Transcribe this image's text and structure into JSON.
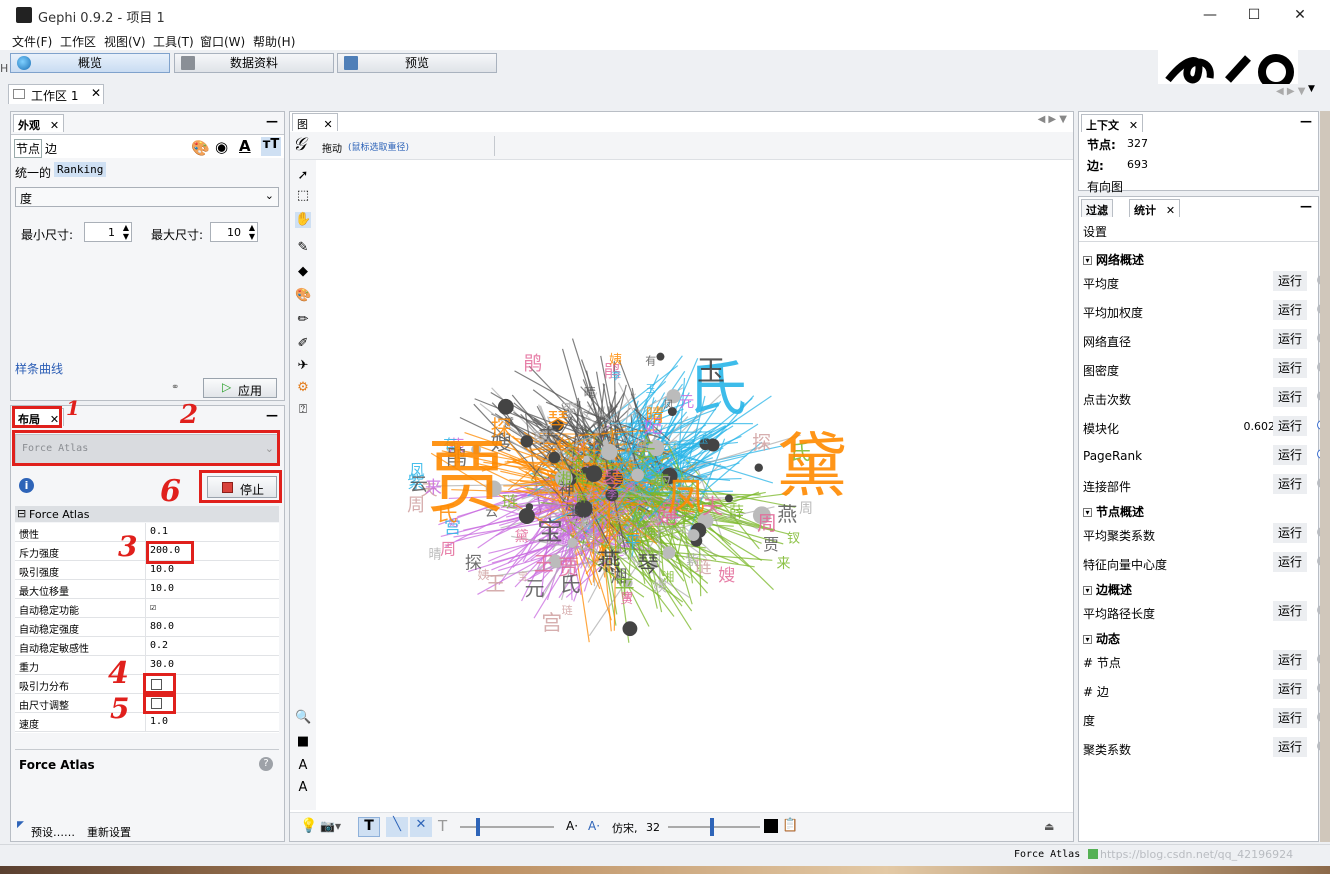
{
  "window": {
    "title": "Gephi 0.9.2 - 项目 1",
    "minimize": "—",
    "maximize": "☐",
    "close": "✕"
  },
  "menu": [
    "文件(F)",
    "工作区",
    "视图(V)",
    "工具(T)",
    "窗口(W)",
    "帮助(H)"
  ],
  "main_tabs": [
    "概览",
    "数据资料",
    "预览"
  ],
  "workspace_tab": "工作区 1",
  "appearance": {
    "title": "外观",
    "tab_nodes": "节点",
    "tab_edges": "边",
    "unique": "统一的",
    "ranking": "Ranking",
    "attribute": "度",
    "min_label": "最小尺寸:",
    "min_value": "1",
    "max_label": "最大尺寸:",
    "max_value": "10",
    "spline": "样条曲线",
    "apply": "应用"
  },
  "layout": {
    "title": "布局",
    "algorithm": "Force Atlas",
    "stop": "停止",
    "section": "Force Atlas",
    "props": [
      {
        "name": "惯性",
        "value": "0.1"
      },
      {
        "name": "斥力强度",
        "value": "200.0"
      },
      {
        "name": "吸引强度",
        "value": "10.0"
      },
      {
        "name": "最大位移量",
        "value": "10.0"
      },
      {
        "name": "自动稳定功能",
        "value": "☑"
      },
      {
        "name": "自动稳定强度",
        "value": "80.0"
      },
      {
        "name": "自动稳定敏感性",
        "value": "0.2"
      },
      {
        "name": "重力",
        "value": "30.0"
      },
      {
        "name": "吸引力分布",
        "value": ""
      },
      {
        "name": "由尺寸调整",
        "value": ""
      },
      {
        "name": "速度",
        "value": "1.0"
      }
    ],
    "desc_title": "Force Atlas",
    "presets": "预设……",
    "reset": "重新设置"
  },
  "annotations": [
    "1",
    "2",
    "3",
    "4",
    "5",
    "6"
  ],
  "graph": {
    "title": "图",
    "drag_tool": "拖动",
    "drag_hint": "(鼠标选取重径)",
    "font": "仿宋,",
    "font_size": "32",
    "words": [
      "贾",
      "宝",
      "黛",
      "氏",
      "玉",
      "周",
      "有",
      "凤",
      "妃",
      "燕",
      "琴",
      "神",
      "来",
      "李",
      "王",
      "宫",
      "钗",
      "夫",
      "姨",
      "嫂",
      "探",
      "元",
      "琏",
      "薛",
      "平",
      "紫",
      "鹃",
      "湘",
      "云",
      "晴"
    ]
  },
  "context": {
    "title": "上下文",
    "nodes_label": "节点:",
    "nodes": "327",
    "edges_label": "边:",
    "edges": "693",
    "type": "有向图"
  },
  "stats": {
    "tab_filter": "过滤",
    "tab_stats": "统计",
    "settings": "设置",
    "run": "运行",
    "sections": [
      {
        "title": "网络概述",
        "items": [
          {
            "name": "平均度",
            "value": ""
          },
          {
            "name": "平均加权度",
            "value": ""
          },
          {
            "name": "网络直径",
            "value": ""
          },
          {
            "name": "图密度",
            "value": ""
          },
          {
            "name": "点击次数",
            "value": ""
          },
          {
            "name": "模块化",
            "value": "0.602"
          },
          {
            "name": "PageRank",
            "value": ""
          },
          {
            "name": "连接部件",
            "value": ""
          }
        ]
      },
      {
        "title": "节点概述",
        "items": [
          {
            "name": "平均聚类系数",
            "value": ""
          },
          {
            "name": "特征向量中心度",
            "value": ""
          }
        ]
      },
      {
        "title": "边概述",
        "items": [
          {
            "name": "平均路径长度",
            "value": ""
          }
        ]
      },
      {
        "title": "动态",
        "items": [
          {
            "name": "# 节点",
            "value": ""
          },
          {
            "name": "# 边",
            "value": ""
          },
          {
            "name": "度",
            "value": ""
          },
          {
            "name": "聚类系数",
            "value": ""
          }
        ]
      }
    ]
  },
  "status": {
    "text": "Force Atlas",
    "watermark": "https://blog.csdn.net/qq_42196924"
  },
  "colors": {
    "accent": "#3b6fd0",
    "annotation": "#e0201c"
  }
}
